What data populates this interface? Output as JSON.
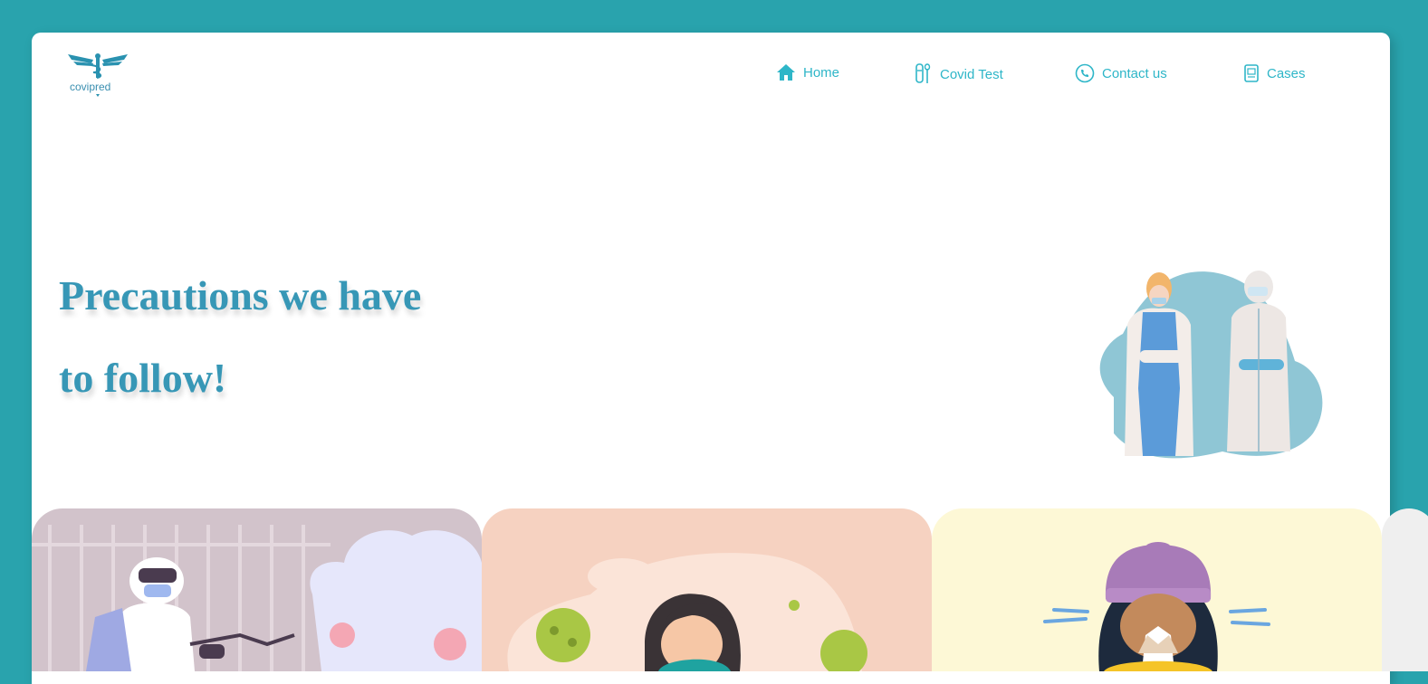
{
  "brand": {
    "name": "covipred",
    "icon": "caduceus-logo-icon"
  },
  "nav": {
    "items": [
      {
        "label": "Home",
        "icon": "home-icon"
      },
      {
        "label": "Covid Test",
        "icon": "test-tube-icon"
      },
      {
        "label": "Contact us",
        "icon": "phone-icon"
      },
      {
        "label": "Cases",
        "icon": "clipboard-icon"
      }
    ]
  },
  "hero": {
    "title_line1": "Precautions we have",
    "title_line2": "to follow!",
    "illustration": "healthcare-workers-illustration"
  },
  "tiles": [
    {
      "illustration": "disinfection-worker-illustration",
      "bg": "#d2c3cb"
    },
    {
      "illustration": "sick-person-illustration",
      "bg": "#f6d2c1"
    },
    {
      "illustration": "sneezing-person-illustration",
      "bg": "#fdf8d6"
    }
  ],
  "colors": {
    "background": "#29a3ad",
    "accent": "#2eb6c8",
    "heading": "#3797b6"
  }
}
